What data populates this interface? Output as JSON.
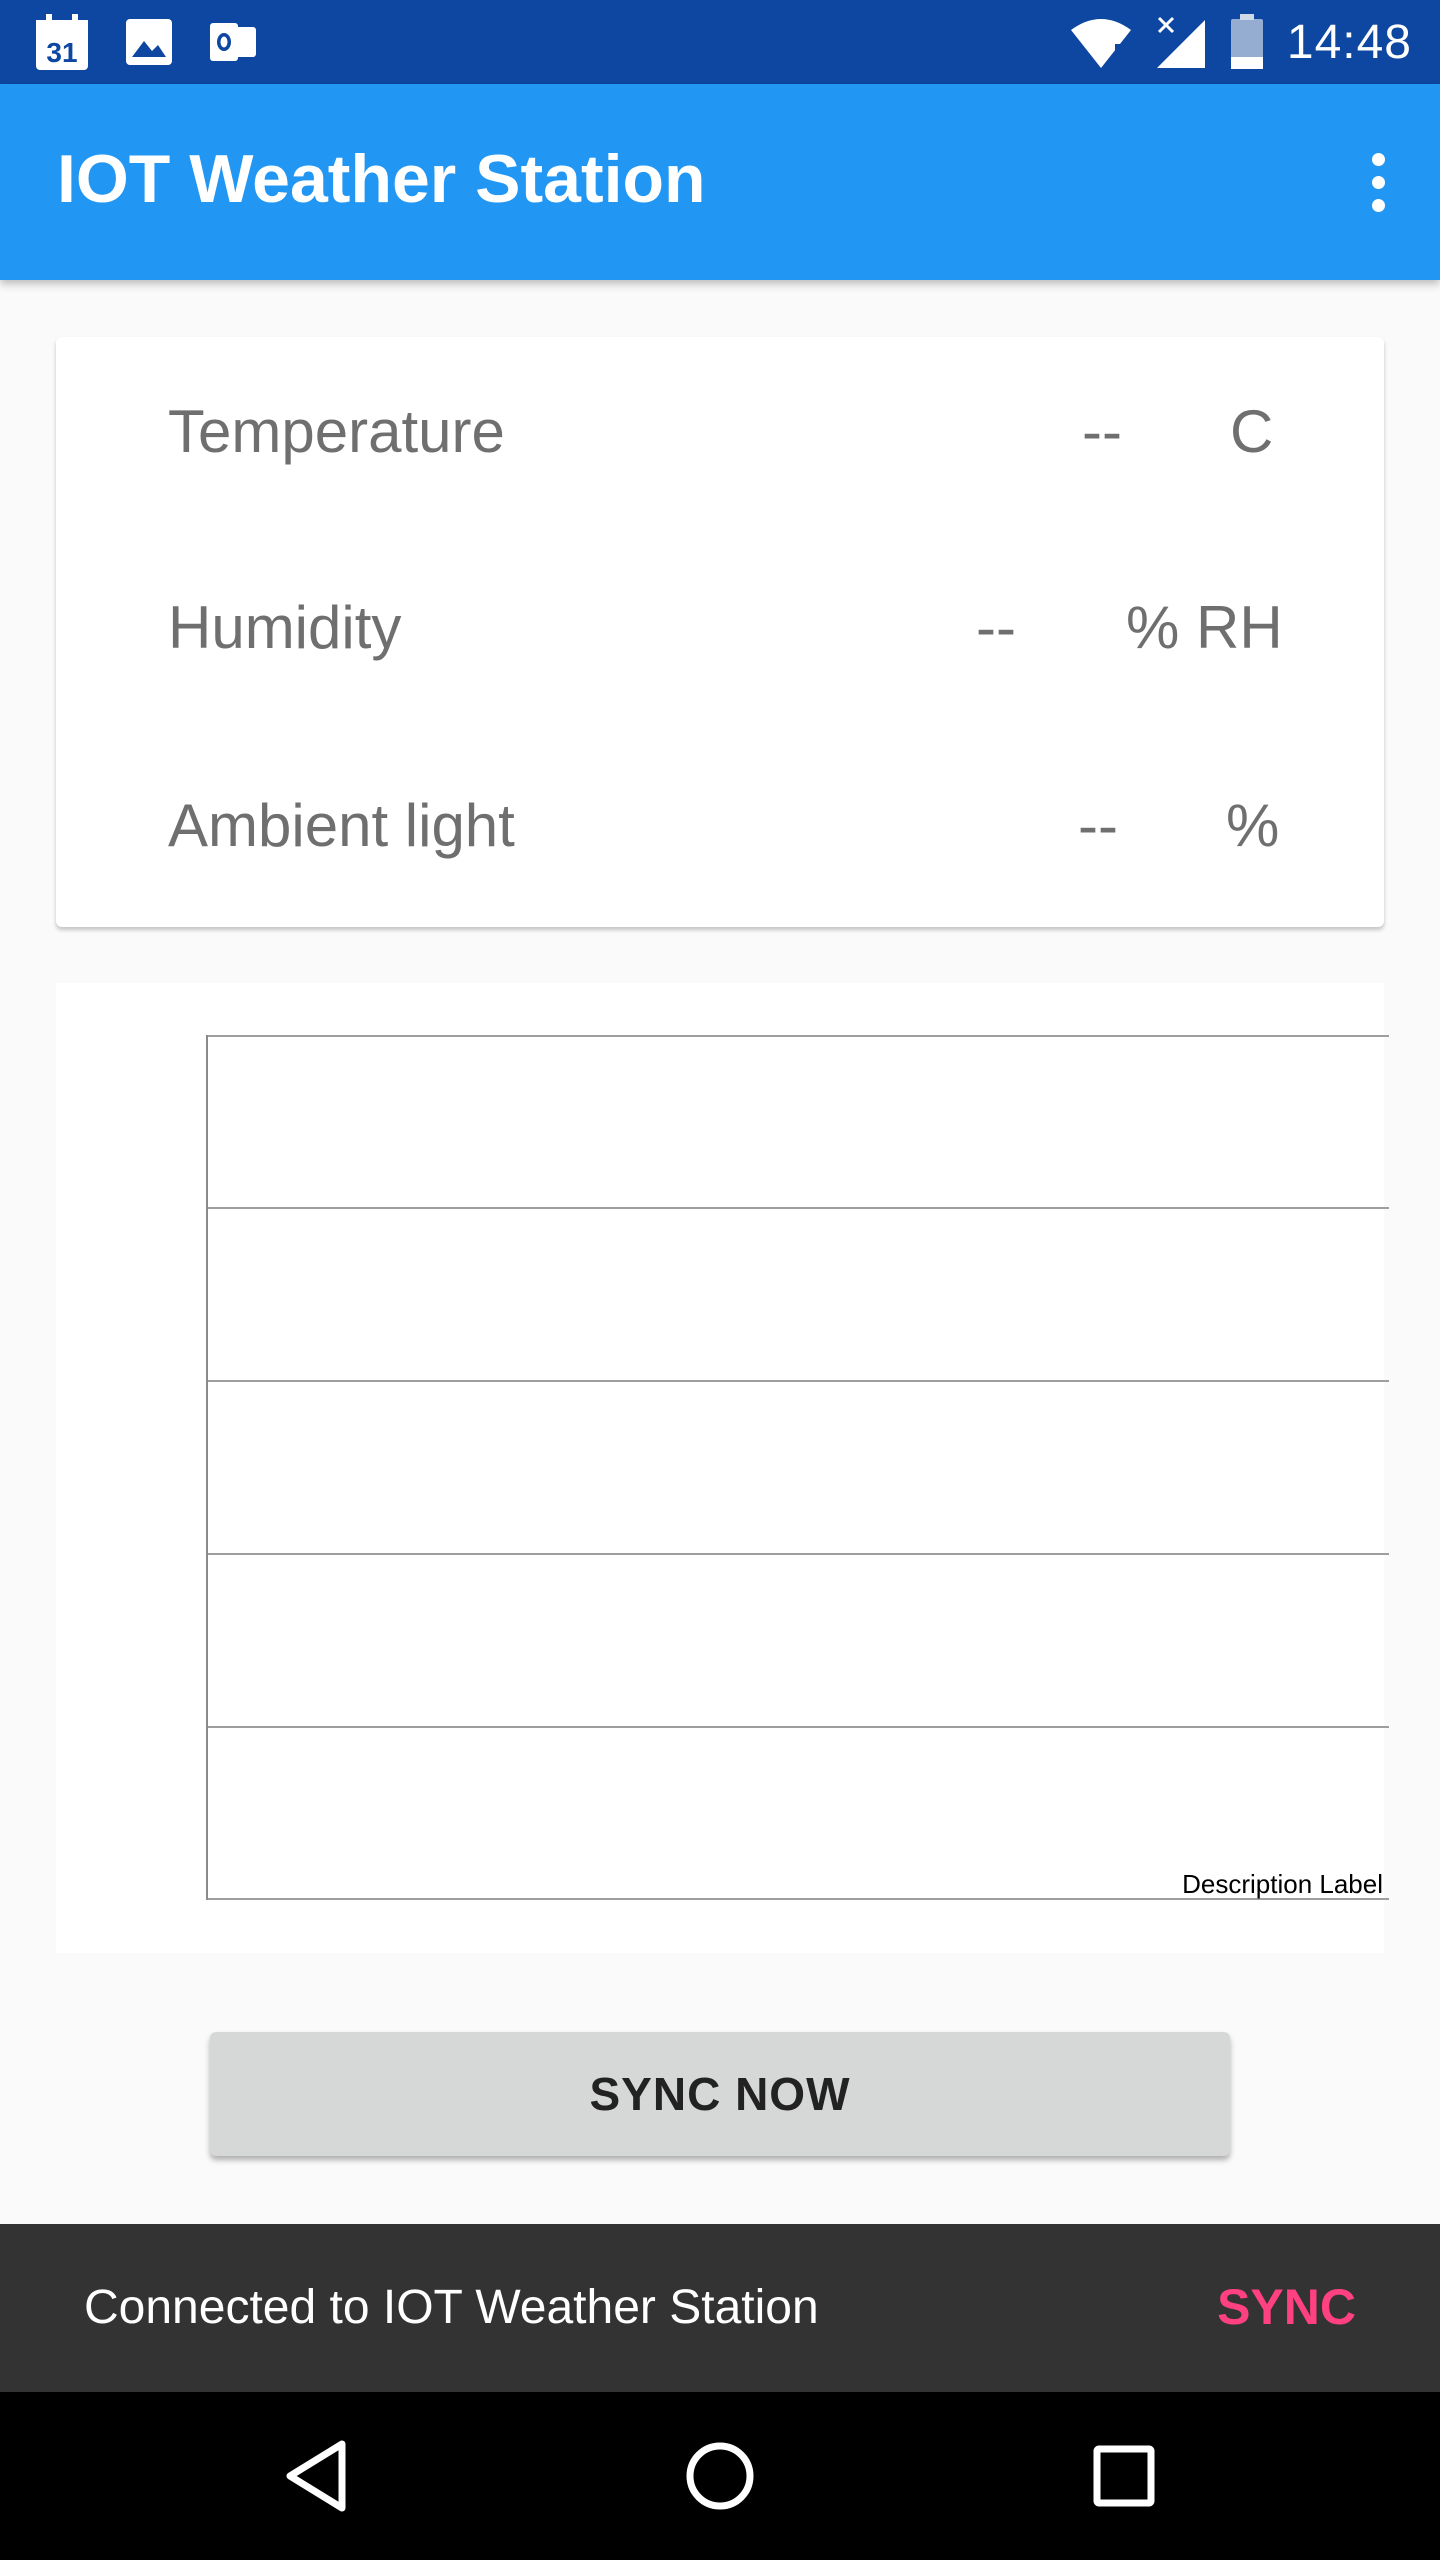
{
  "status_bar": {
    "calendar_day": "31",
    "time": "14:48",
    "left_icons": [
      "calendar-icon",
      "gallery-icon",
      "outlook-icon"
    ],
    "right_icons": [
      "wifi-icon",
      "signal-icon",
      "battery-icon"
    ]
  },
  "app_bar": {
    "title": "IOT Weather Station",
    "menu_icon": "more-vert-icon"
  },
  "readings": [
    {
      "label": "Temperature",
      "value": "--",
      "unit": "C"
    },
    {
      "label": "Humidity",
      "value": "--",
      "unit": "% RH"
    },
    {
      "label": "Ambient light",
      "value": "--",
      "unit": "%"
    }
  ],
  "chart": {
    "description_label": "Description Label",
    "gridlines": 5
  },
  "sync_button": {
    "label": "SYNC NOW"
  },
  "snackbar": {
    "message": "Connected to IOT Weather Station",
    "action": "SYNC",
    "action_color": "#ff4081"
  },
  "nav_bar": {
    "buttons": [
      "back-icon",
      "home-icon",
      "recents-icon"
    ]
  },
  "colors": {
    "primary": "#2196f3",
    "primary_dark": "#0d47a1"
  }
}
